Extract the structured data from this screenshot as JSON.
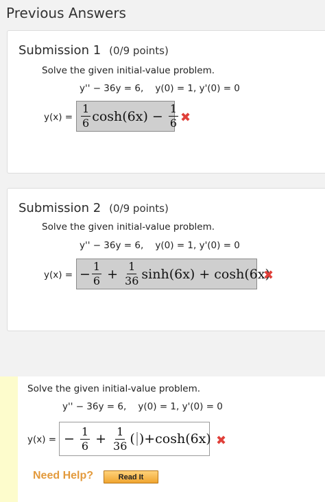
{
  "page_title": "Previous Answers",
  "problem": {
    "prompt": "Solve the given initial-value problem.",
    "equation": "y'' − 36y = 6,    y(0) = 1, y'(0) = 0",
    "y_label": "y(x) ="
  },
  "submissions": [
    {
      "title": "Submission 1",
      "points": "(0/9 points)",
      "answer": {
        "f1_num": "1",
        "f1_den": "6",
        "term1": "cosh(6x)",
        "minus": "−",
        "f2_num": "1",
        "f2_den": "6"
      },
      "status_icon": "wrong-x-icon",
      "status_glyph": "✖"
    },
    {
      "title": "Submission 2",
      "points": "(0/9 points)",
      "answer": {
        "lead": "−",
        "f1_num": "1",
        "f1_den": "6",
        "plus1": "+",
        "f2_num": "1",
        "f2_den": "36",
        "term1": "sinh(6x)",
        "plus2": "+",
        "term2": "cosh(6x)"
      },
      "status_icon": "wrong-x-icon",
      "status_glyph": "✖"
    }
  ],
  "current": {
    "answer": {
      "lead": "−",
      "f1_num": "1",
      "f1_den": "6",
      "plus1": "+",
      "f2_num": "1",
      "f2_den": "36",
      "paren_open": "(",
      "paren_close": ")+cosh(6x)"
    },
    "status_icon": "wrong-x-icon",
    "status_glyph": "✖",
    "need_help": "Need Help?",
    "read_it": "Read It"
  },
  "colors": {
    "wrong": "#e0403a",
    "highlight_bar": "#fdfccc",
    "need_help": "#e39a3c",
    "read_it_bg": "#f0a530"
  }
}
